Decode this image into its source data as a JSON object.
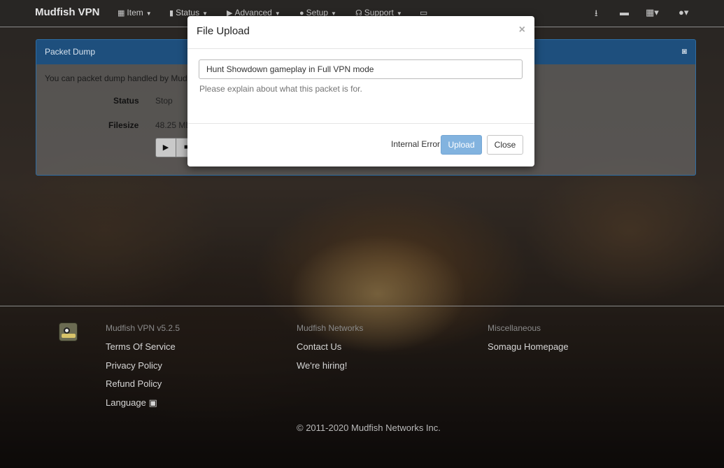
{
  "navbar": {
    "brand": "Mudfish VPN",
    "items": [
      {
        "label": "Item",
        "icon": "grid-icon"
      },
      {
        "label": "Status",
        "icon": "bar-chart-icon"
      },
      {
        "label": "Advanced",
        "icon": "fast-forward-icon"
      },
      {
        "label": "Setup",
        "icon": "user-icon"
      },
      {
        "label": "Support",
        "icon": "headset-icon"
      }
    ],
    "right_icons": [
      "download-icon",
      "comment-icon",
      "apps-grid-icon",
      "user-account-icon"
    ]
  },
  "panel": {
    "title": "Packet Dump",
    "description": "You can packet dump handled by Mudfis",
    "status_label": "Status",
    "status_value": "Stop",
    "filesize_label": "Filesize",
    "filesize_value": "48.25 ME",
    "play_glyph": "▶",
    "stop_glyph": "■"
  },
  "modal": {
    "title": "File Upload",
    "close_glyph": "×",
    "input_value": "Hunt Showdown gameplay in Full VPN mode",
    "help_text": "Please explain about what this packet is for.",
    "status_text": "Internal Error",
    "upload_label": "Upload",
    "close_label": "Close"
  },
  "footer": {
    "col1": {
      "heading": "Mudfish VPN v5.2.5",
      "links": [
        "Terms Of Service",
        "Privacy Policy",
        "Refund Policy",
        "Language"
      ]
    },
    "col2": {
      "heading": "Mudfish Networks",
      "links": [
        "Contact Us",
        "We're hiring!"
      ]
    },
    "col3": {
      "heading": "Miscellaneous",
      "links": [
        "Somagu Homepage"
      ]
    },
    "copyright": "© 2011-2020 Mudfish Networks Inc."
  },
  "colors": {
    "panel_header": "#1e4f7d",
    "upload_button": "#82b3df"
  }
}
